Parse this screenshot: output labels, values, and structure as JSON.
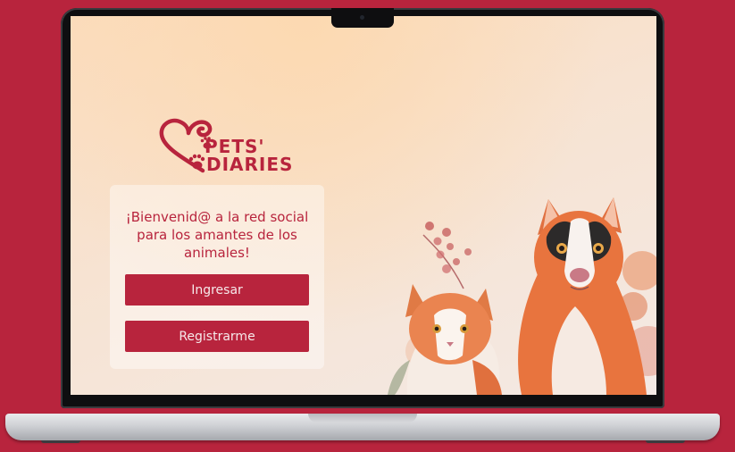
{
  "brand": {
    "line1": "PETS'",
    "line2": "DIARIES",
    "color": "#b8243d"
  },
  "welcome": {
    "text": "¡Bienvenid@ a la red social para los  amantes de  los animales!"
  },
  "buttons": {
    "login": "Ingresar",
    "register": "Registrarme"
  },
  "illustration": {
    "subject": "watercolor-dog-and-cat"
  },
  "colors": {
    "background": "#b8243d",
    "accent": "#b8243d",
    "button_text": "#f6e9ea"
  }
}
